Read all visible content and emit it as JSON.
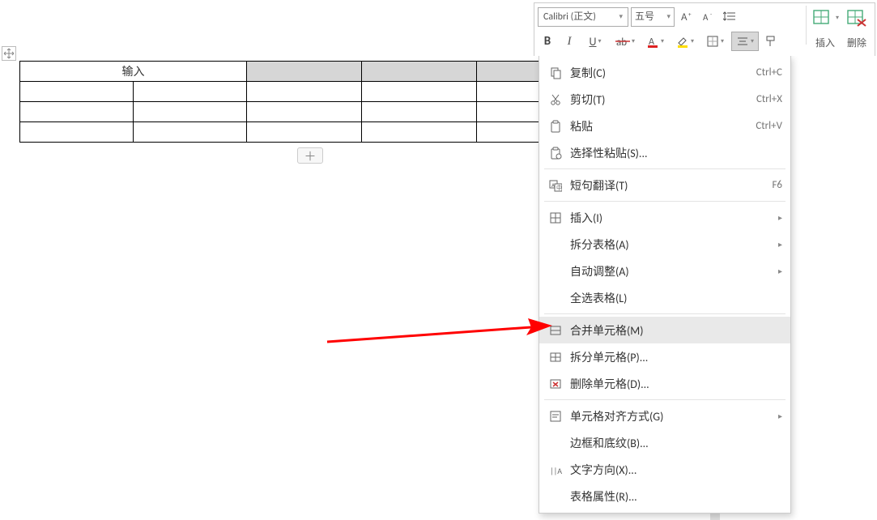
{
  "toolbar": {
    "font_name": "Calibri (正文)",
    "font_size": "五号",
    "insert_label": "插入",
    "delete_label": "删除"
  },
  "table": {
    "header_cell": "输入"
  },
  "menu": {
    "copy": "复制(C)",
    "copy_accel": "Ctrl+C",
    "cut": "剪切(T)",
    "cut_accel": "Ctrl+X",
    "paste": "粘贴",
    "paste_accel": "Ctrl+V",
    "paste_special": "选择性粘贴(S)...",
    "translate": "短句翻译(T)",
    "translate_accel": "F6",
    "insert": "插入(I)",
    "split_table": "拆分表格(A)",
    "autofit": "自动调整(A)",
    "select_table": "全选表格(L)",
    "merge_cells": "合并单元格(M)",
    "split_cells": "拆分单元格(P)...",
    "delete_cells": "删除单元格(D)...",
    "cell_align": "单元格对齐方式(G)",
    "borders_shading": "边框和底纹(B)...",
    "text_direction": "文字方向(X)...",
    "table_props": "表格属性(R)..."
  }
}
